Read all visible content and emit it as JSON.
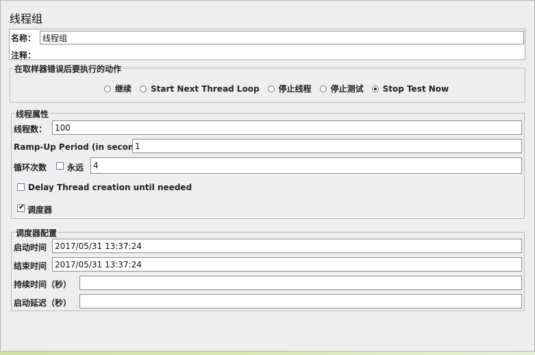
{
  "header": {
    "title": "线程组"
  },
  "name_row": {
    "label": "名称：",
    "value": "线程组"
  },
  "comment_row": {
    "label": "注释：",
    "value": ""
  },
  "error_action": {
    "legend": "在取样器错误后要执行的动作",
    "options": [
      {
        "label": "继续",
        "selected": false
      },
      {
        "label": "Start Next Thread Loop",
        "selected": false
      },
      {
        "label": "停止线程",
        "selected": false
      },
      {
        "label": "停止测试",
        "selected": false
      },
      {
        "label": "Stop Test Now",
        "selected": true
      }
    ]
  },
  "thread_props": {
    "legend": "线程属性",
    "threads_label": "线程数：",
    "threads_value": "100",
    "rampup_label": "Ramp-Up Period (in seconds):",
    "rampup_value": "1",
    "loop_label": "循环次数",
    "forever_label": "永远",
    "forever_checked": false,
    "loop_value": "4",
    "delay_label": "Delay Thread creation until needed",
    "delay_checked": false,
    "scheduler_label": "调度器",
    "scheduler_checked": true
  },
  "scheduler_config": {
    "legend": "调度器配置",
    "start_label": "启动时间",
    "start_value": "2017/05/31 13:37:24",
    "end_label": "结束时间",
    "end_value": "2017/05/31 13:37:24",
    "duration_label": "持续时间（秒）",
    "duration_value": "",
    "delay_label": "启动延迟（秒）",
    "delay_value": ""
  }
}
